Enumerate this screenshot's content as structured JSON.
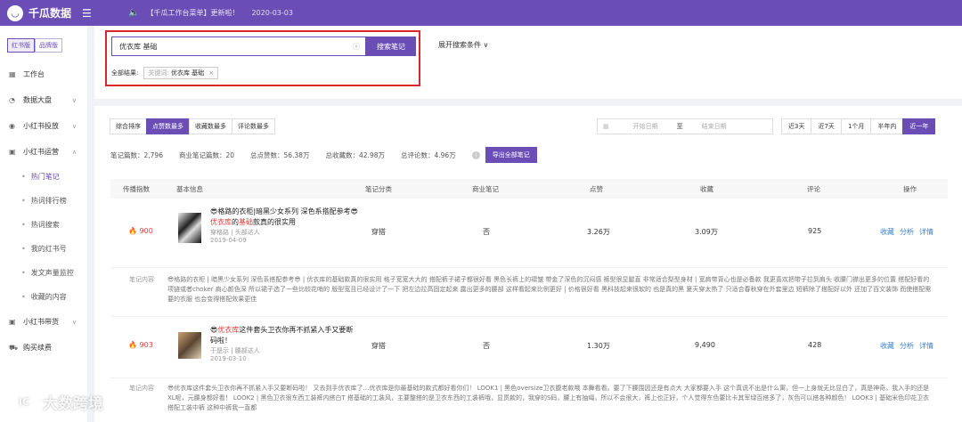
{
  "header": {
    "brand": "千瓜数据",
    "notice": "【千瓜工作台菜单】更新啦！",
    "notice_date": "2020-03-03"
  },
  "sidebar": {
    "platform_tabs": [
      "红书版",
      "品牌版"
    ],
    "items": [
      {
        "label": "工作台"
      },
      {
        "label": "数据大盘"
      },
      {
        "label": "小红书投放"
      },
      {
        "label": "小红书运营"
      },
      {
        "label": "小红书带货"
      },
      {
        "label": "购买续费"
      }
    ],
    "sub_items": [
      "热门笔记",
      "热词排行榜",
      "热词搜索",
      "我的红书号",
      "发文声量监控",
      "收藏的内容"
    ]
  },
  "search": {
    "value": "优衣库 基础",
    "button": "搜索笔记",
    "result_label": "全部结果:",
    "chip_key": "关键词:",
    "chip_value": "优衣库 基础",
    "expand": "展开搜索条件"
  },
  "sort_tabs": [
    "综合排序",
    "点赞数最多",
    "收藏数最多",
    "评论数最多"
  ],
  "date_range": {
    "start_placeholder": "开始日期",
    "sep": "至",
    "end_placeholder": "结束日期"
  },
  "period_tabs": [
    "近3天",
    "近7天",
    "1个月",
    "半年内",
    "近一年"
  ],
  "stats": {
    "notes": "笔记篇数：2,796",
    "commercial": "商业笔记篇数：20",
    "likes": "总点赞数：56.38万",
    "collects": "总收藏数：42.98万",
    "comments": "总评论数：4.96万",
    "export": "导出全部笔记"
  },
  "table": {
    "headers": [
      "传播指数",
      "基本信息",
      "笔记分类",
      "商业笔记",
      "点赞",
      "收藏",
      "评论",
      "操作"
    ],
    "ops": [
      "收藏",
      "分析",
      "详情"
    ],
    "desc_label": "笔记内容",
    "rows": [
      {
        "index": "900",
        "title_a": "😎格路的衣柜|暗黑少女系列 深色系搭配参考😎",
        "title_hl": "优衣库",
        "title_b": "的",
        "title_hl2": "基础",
        "title_c": "款真的很实用",
        "author": "穿格路 | 头部达人",
        "date": "2019-04-09",
        "category": "穿搭",
        "commercial": "否",
        "likes": "3.26万",
        "collects": "3.09万",
        "comments": "925",
        "desc": "😎格路的衣柜 | 暗黑少女系列 深色系搭配参考😎 | 优衣库的基础款真的很实用 格子宽宽大大的 搭配裤子裙子都很好看 黑色长裤上的褶皱 带金了深色的沉闷感 裤型很显腿直 非常适合梨型身材 | 宽肩带背心也是必备款 我更喜欢把带子拉到肩头 收腰门襟出更多的位置 搭配好看的项链或者choker 肩心颜色深 所以裙子选了一些比较花哨的 版型宽且已经设计了一下 把左边拉高固定起来 露出更多的腰部 这样看起来比例更好 | 价格很好看 黑科技起来很软的 也是真的黑 夏天穿太热了 只适合春秋穿在外套里边 短裤除了搭配好以外 还加了百文装饰 而使搭配需要的衣服 也会变得搭配效果更佳"
      },
      {
        "index": "903",
        "title_a": "😎",
        "title_hl": "优衣库",
        "title_b": "这件套头卫衣你再不抓紧入手又要断码啦！",
        "title_hl2": "",
        "title_c": "",
        "author": "于是示 | 腰部达人",
        "date": "2019-03-10",
        "category": "穿搭",
        "commercial": "否",
        "likes": "1.30万",
        "collects": "9,490",
        "comments": "428",
        "desc": "😎优衣库这件套头卫衣你再不抓紧入手又要断码啦！ 又去到手优衣库了…优衣库是你最基础的款式都好看你们！ LOOK1 | 黑色oversize卫衣腹老款哦 本舞看看。要了下腰围因还是有点大 大家都要入手 这个真说不出是什么寓，但一上身就无比显白了，真是神奇。我入手的还是XL呢，元腰身都好看！ LOOK2 | 黑色卫衣很东西工装裤内搭白T 搭基础的工装风，主要整搭的是卫衣东西的工装裤哦，显贯款的，我穿的S码，腰上有抽绳，所以不会很大，裤上也正好，个人觉得东色要比卡其军绿百搭多了，灰色可以搭各种颜色！ LOOK3 | 基础米色印花卫衣搭配工装中裤 这种中裤我一直都"
      }
    ]
  }
}
